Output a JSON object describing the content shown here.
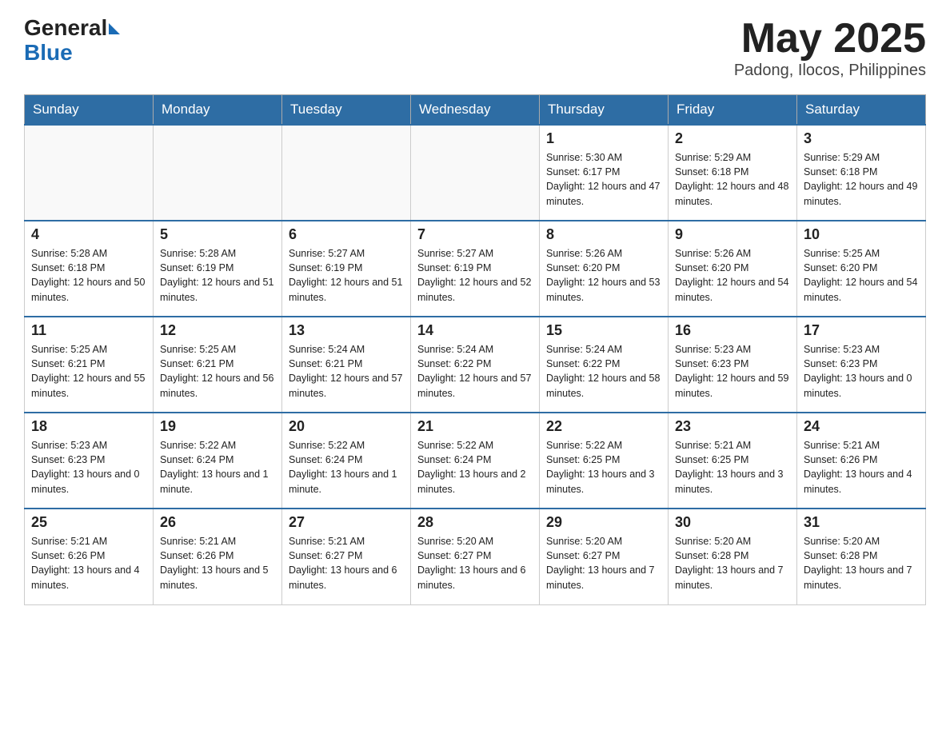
{
  "header": {
    "logo_general": "General",
    "logo_blue": "Blue",
    "title": "May 2025",
    "subtitle": "Padong, Ilocos, Philippines"
  },
  "weekdays": [
    "Sunday",
    "Monday",
    "Tuesday",
    "Wednesday",
    "Thursday",
    "Friday",
    "Saturday"
  ],
  "weeks": [
    [
      {
        "day": "",
        "sunrise": "",
        "sunset": "",
        "daylight": ""
      },
      {
        "day": "",
        "sunrise": "",
        "sunset": "",
        "daylight": ""
      },
      {
        "day": "",
        "sunrise": "",
        "sunset": "",
        "daylight": ""
      },
      {
        "day": "",
        "sunrise": "",
        "sunset": "",
        "daylight": ""
      },
      {
        "day": "1",
        "sunrise": "Sunrise: 5:30 AM",
        "sunset": "Sunset: 6:17 PM",
        "daylight": "Daylight: 12 hours and 47 minutes."
      },
      {
        "day": "2",
        "sunrise": "Sunrise: 5:29 AM",
        "sunset": "Sunset: 6:18 PM",
        "daylight": "Daylight: 12 hours and 48 minutes."
      },
      {
        "day": "3",
        "sunrise": "Sunrise: 5:29 AM",
        "sunset": "Sunset: 6:18 PM",
        "daylight": "Daylight: 12 hours and 49 minutes."
      }
    ],
    [
      {
        "day": "4",
        "sunrise": "Sunrise: 5:28 AM",
        "sunset": "Sunset: 6:18 PM",
        "daylight": "Daylight: 12 hours and 50 minutes."
      },
      {
        "day": "5",
        "sunrise": "Sunrise: 5:28 AM",
        "sunset": "Sunset: 6:19 PM",
        "daylight": "Daylight: 12 hours and 51 minutes."
      },
      {
        "day": "6",
        "sunrise": "Sunrise: 5:27 AM",
        "sunset": "Sunset: 6:19 PM",
        "daylight": "Daylight: 12 hours and 51 minutes."
      },
      {
        "day": "7",
        "sunrise": "Sunrise: 5:27 AM",
        "sunset": "Sunset: 6:19 PM",
        "daylight": "Daylight: 12 hours and 52 minutes."
      },
      {
        "day": "8",
        "sunrise": "Sunrise: 5:26 AM",
        "sunset": "Sunset: 6:20 PM",
        "daylight": "Daylight: 12 hours and 53 minutes."
      },
      {
        "day": "9",
        "sunrise": "Sunrise: 5:26 AM",
        "sunset": "Sunset: 6:20 PM",
        "daylight": "Daylight: 12 hours and 54 minutes."
      },
      {
        "day": "10",
        "sunrise": "Sunrise: 5:25 AM",
        "sunset": "Sunset: 6:20 PM",
        "daylight": "Daylight: 12 hours and 54 minutes."
      }
    ],
    [
      {
        "day": "11",
        "sunrise": "Sunrise: 5:25 AM",
        "sunset": "Sunset: 6:21 PM",
        "daylight": "Daylight: 12 hours and 55 minutes."
      },
      {
        "day": "12",
        "sunrise": "Sunrise: 5:25 AM",
        "sunset": "Sunset: 6:21 PM",
        "daylight": "Daylight: 12 hours and 56 minutes."
      },
      {
        "day": "13",
        "sunrise": "Sunrise: 5:24 AM",
        "sunset": "Sunset: 6:21 PM",
        "daylight": "Daylight: 12 hours and 57 minutes."
      },
      {
        "day": "14",
        "sunrise": "Sunrise: 5:24 AM",
        "sunset": "Sunset: 6:22 PM",
        "daylight": "Daylight: 12 hours and 57 minutes."
      },
      {
        "day": "15",
        "sunrise": "Sunrise: 5:24 AM",
        "sunset": "Sunset: 6:22 PM",
        "daylight": "Daylight: 12 hours and 58 minutes."
      },
      {
        "day": "16",
        "sunrise": "Sunrise: 5:23 AM",
        "sunset": "Sunset: 6:23 PM",
        "daylight": "Daylight: 12 hours and 59 minutes."
      },
      {
        "day": "17",
        "sunrise": "Sunrise: 5:23 AM",
        "sunset": "Sunset: 6:23 PM",
        "daylight": "Daylight: 13 hours and 0 minutes."
      }
    ],
    [
      {
        "day": "18",
        "sunrise": "Sunrise: 5:23 AM",
        "sunset": "Sunset: 6:23 PM",
        "daylight": "Daylight: 13 hours and 0 minutes."
      },
      {
        "day": "19",
        "sunrise": "Sunrise: 5:22 AM",
        "sunset": "Sunset: 6:24 PM",
        "daylight": "Daylight: 13 hours and 1 minute."
      },
      {
        "day": "20",
        "sunrise": "Sunrise: 5:22 AM",
        "sunset": "Sunset: 6:24 PM",
        "daylight": "Daylight: 13 hours and 1 minute."
      },
      {
        "day": "21",
        "sunrise": "Sunrise: 5:22 AM",
        "sunset": "Sunset: 6:24 PM",
        "daylight": "Daylight: 13 hours and 2 minutes."
      },
      {
        "day": "22",
        "sunrise": "Sunrise: 5:22 AM",
        "sunset": "Sunset: 6:25 PM",
        "daylight": "Daylight: 13 hours and 3 minutes."
      },
      {
        "day": "23",
        "sunrise": "Sunrise: 5:21 AM",
        "sunset": "Sunset: 6:25 PM",
        "daylight": "Daylight: 13 hours and 3 minutes."
      },
      {
        "day": "24",
        "sunrise": "Sunrise: 5:21 AM",
        "sunset": "Sunset: 6:26 PM",
        "daylight": "Daylight: 13 hours and 4 minutes."
      }
    ],
    [
      {
        "day": "25",
        "sunrise": "Sunrise: 5:21 AM",
        "sunset": "Sunset: 6:26 PM",
        "daylight": "Daylight: 13 hours and 4 minutes."
      },
      {
        "day": "26",
        "sunrise": "Sunrise: 5:21 AM",
        "sunset": "Sunset: 6:26 PM",
        "daylight": "Daylight: 13 hours and 5 minutes."
      },
      {
        "day": "27",
        "sunrise": "Sunrise: 5:21 AM",
        "sunset": "Sunset: 6:27 PM",
        "daylight": "Daylight: 13 hours and 6 minutes."
      },
      {
        "day": "28",
        "sunrise": "Sunrise: 5:20 AM",
        "sunset": "Sunset: 6:27 PM",
        "daylight": "Daylight: 13 hours and 6 minutes."
      },
      {
        "day": "29",
        "sunrise": "Sunrise: 5:20 AM",
        "sunset": "Sunset: 6:27 PM",
        "daylight": "Daylight: 13 hours and 7 minutes."
      },
      {
        "day": "30",
        "sunrise": "Sunrise: 5:20 AM",
        "sunset": "Sunset: 6:28 PM",
        "daylight": "Daylight: 13 hours and 7 minutes."
      },
      {
        "day": "31",
        "sunrise": "Sunrise: 5:20 AM",
        "sunset": "Sunset: 6:28 PM",
        "daylight": "Daylight: 13 hours and 7 minutes."
      }
    ]
  ]
}
